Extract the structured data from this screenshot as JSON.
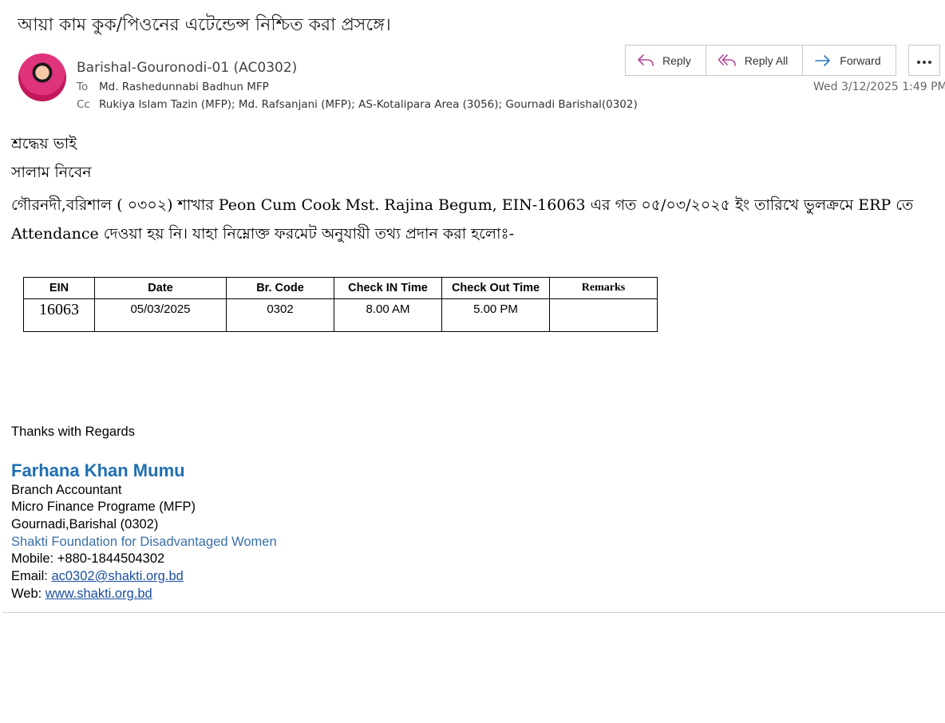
{
  "email": {
    "subject": "আয়া কাম কুক/পিওনের এটেন্ডেন্স নিশ্চিত করা প্রসঙ্গে।",
    "sender": "Barishal-Gouronodi-01 (AC0302)",
    "to_label": "To",
    "to": "Md. Rashedunnabi Badhun MFP",
    "cc_label": "Cc",
    "cc": "Rukiya Islam Tazin (MFP); Md. Rafsanjani (MFP); AS-Kotalipara Area (3056); Gournadi Barishal(0302)",
    "date": "Wed 3/12/2025 1:49 PM"
  },
  "actions": {
    "reply": "Reply",
    "reply_all": "Reply All",
    "forward": "Forward",
    "more_icon": "more-horizontal-icon",
    "accent_color": "#b0479a",
    "forward_color": "#2b73c9"
  },
  "body": {
    "greeting": "শ্রদ্ধেয় ভাই",
    "salam": "সালাম নিবেন",
    "line1": "গৌরনদী,বরিশাল ( ০৩০২) শাখার Peon Cum Cook  Mst. Rajina Begum, EIN-16063 এর  গত  ০৫/০৩/২০২৫ ইং তারিখে ভুলক্রমে ERP তে",
    "line2": "Attendance দেওয়া হয় নি। যাহা নিম্নোক্ত ফরমেট অনুযায়ী তথ্য প্রদান করা হলোঃ-"
  },
  "table": {
    "headers": [
      "EIN",
      "Date",
      "Br. Code",
      "Check IN Time",
      "Check Out Time",
      "Remarks"
    ],
    "row": [
      "16063",
      "05/03/2025",
      "0302",
      "8.00 AM",
      "5.00 PM",
      ""
    ]
  },
  "signature": {
    "closing": "Thanks with Regards",
    "name": "Farhana Khan Mumu",
    "title": "Branch Accountant",
    "program": "Micro Finance Programe (MFP)",
    "branch": "Gournadi,Barishal (0302)",
    "org": "Shakti Foundation for Disadvantaged Women",
    "mobile": "Mobile: +880-1844504302",
    "email_label": "Email: ",
    "email": "ac0302@shakti.org.bd",
    "web_label": "Web: ",
    "web": "www.shakti.org.bd"
  }
}
